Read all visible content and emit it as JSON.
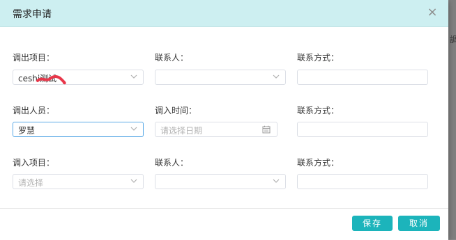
{
  "background": {
    "partial_char": "調"
  },
  "dialog": {
    "title": "需求申请",
    "close_glyph": "×",
    "rows": [
      {
        "c1_label": "调出项目：",
        "c1_value": "ceshi测试",
        "c2_label": "联系人：",
        "c2_value": "",
        "c3_label": "联系方式：",
        "c3_value": ""
      },
      {
        "c1_label": "调出人员：",
        "c1_value": "罗慧",
        "c2_label": "调入时间：",
        "c2_placeholder": "请选择日期",
        "c3_label": "联系方式：",
        "c3_value": ""
      },
      {
        "c1_label": "调入项目：",
        "c1_placeholder": "请选择",
        "c2_label": "联系人：",
        "c2_value": "",
        "c3_label": "联系方式：",
        "c3_value": ""
      }
    ],
    "buttons": {
      "save": "保存",
      "cancel": "取消"
    }
  },
  "colors": {
    "header_bg": "#cdeff1",
    "button": "#1cb4bb",
    "focus_border": "#5aa9e6",
    "annotation": "#e8374a"
  }
}
